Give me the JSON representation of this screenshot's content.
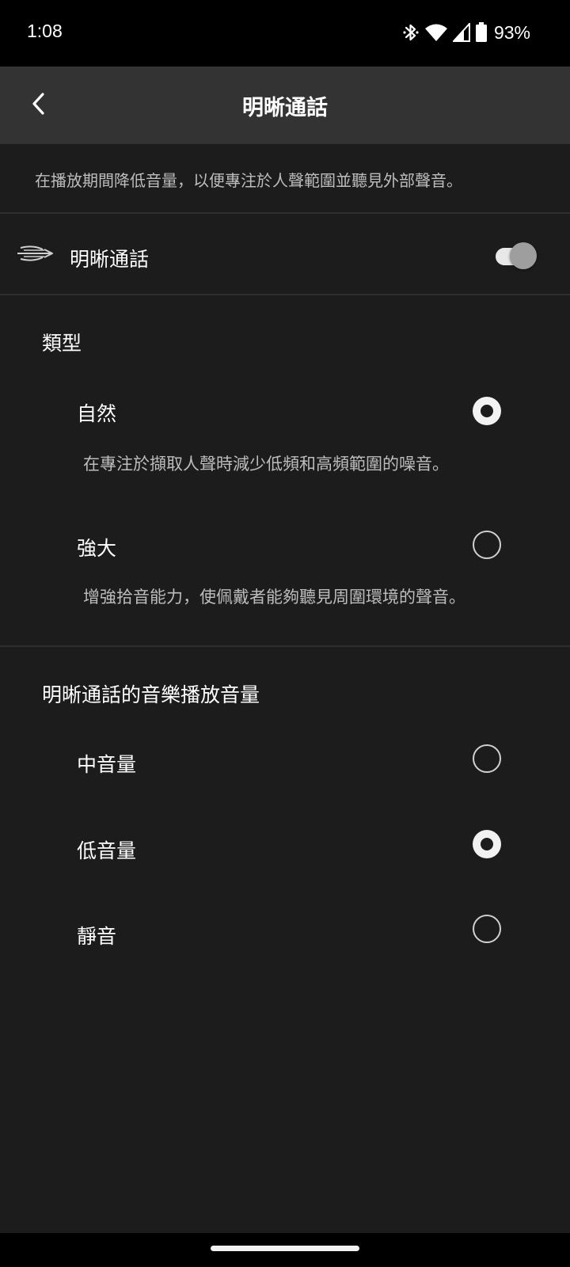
{
  "status_bar": {
    "time": "1:08",
    "battery_percent": "93%",
    "icons": [
      "bluetooth-icon",
      "wifi-icon",
      "cell-signal-icon",
      "battery-icon"
    ]
  },
  "app_bar": {
    "title": "明晰通話",
    "back_icon": "chevron-left-icon"
  },
  "description": "在播放期間降低音量，以便專注於人聲範圍並聽見外部聲音。",
  "clear_talk": {
    "label": "明晰通話",
    "icon": "clear-talk-icon",
    "enabled": true
  },
  "type_section": {
    "title": "類型",
    "options": [
      {
        "label": "自然",
        "description": "在專注於擷取人聲時減少低頻和高頻範圍的噪音。",
        "selected": true
      },
      {
        "label": "強大",
        "description": "增強拾音能力，使佩戴者能夠聽見周圍環境的聲音。",
        "selected": false
      }
    ]
  },
  "volume_section": {
    "title": "明晰通話的音樂播放音量",
    "options": [
      {
        "label": "中音量",
        "selected": false
      },
      {
        "label": "低音量",
        "selected": true
      },
      {
        "label": "靜音",
        "selected": false
      }
    ]
  },
  "colors": {
    "background": "#1c1c1c",
    "app_bar": "#333333",
    "text_primary": "#ffffff",
    "text_secondary": "#bdbdbd",
    "radio_selected": "#f2f2f2"
  }
}
